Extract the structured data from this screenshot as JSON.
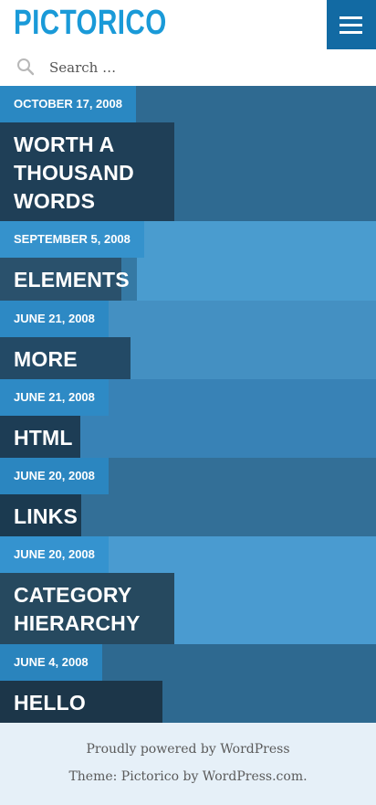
{
  "site": {
    "title": "PICTORICO"
  },
  "search": {
    "placeholder": "Search …"
  },
  "posts": [
    {
      "date": "OCTOBER 17, 2008",
      "title": "WORTH A THOUSAND WORDS"
    },
    {
      "date": "SEPTEMBER 5, 2008",
      "title": "ELEMENTS"
    },
    {
      "date": "JUNE 21, 2008",
      "title": "MORE TAGS"
    },
    {
      "date": "JUNE 21, 2008",
      "title": "HTML"
    },
    {
      "date": "JUNE 20, 2008",
      "title": "LINKS"
    },
    {
      "date": "JUNE 20, 2008",
      "title": "CATEGORY HIERARCHY"
    },
    {
      "date": "JUNE 4, 2008",
      "title": "HELLO WORLD!"
    }
  ],
  "footer": {
    "powered": "Proudly powered by WordPress",
    "theme": "Theme: Pictorico by WordPress.com."
  },
  "colors": {
    "brand": "#1a9ad8",
    "menu_bg": "#126aa3",
    "footer_bg": "#e6f0f8"
  }
}
